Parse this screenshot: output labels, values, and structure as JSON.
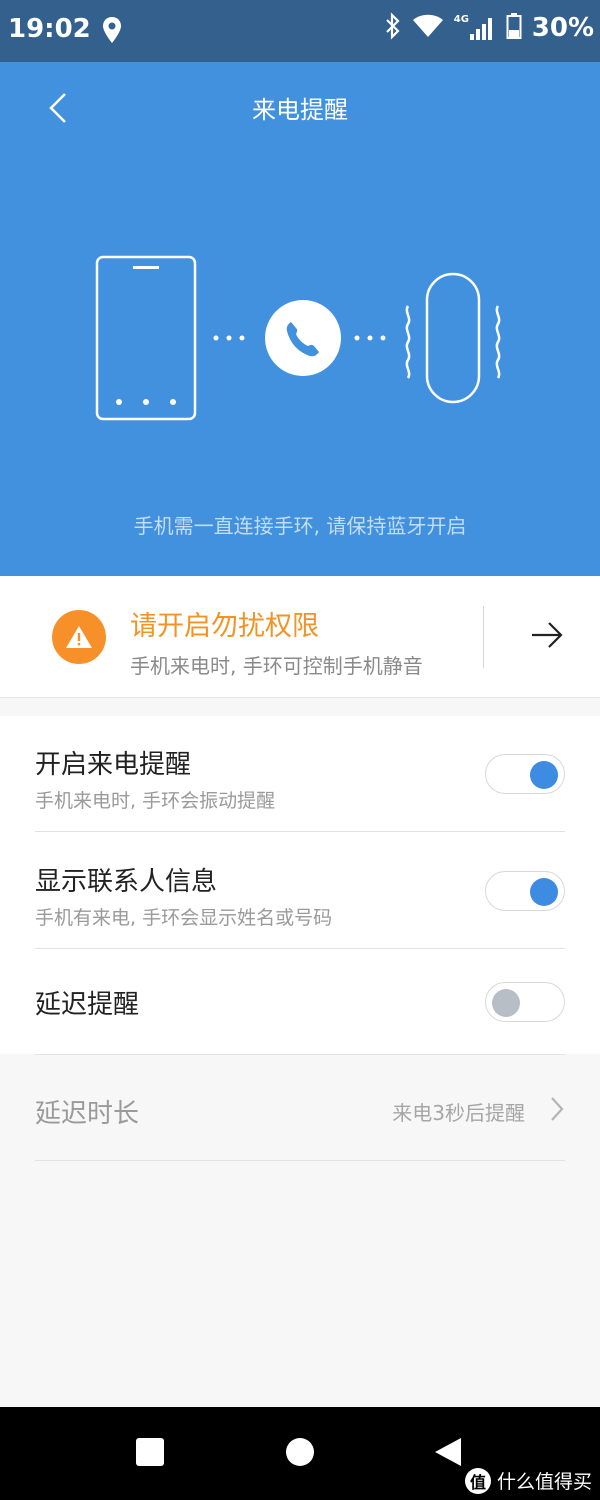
{
  "status_bar": {
    "time": "19:02",
    "battery_text": "30%",
    "network_label": "4G",
    "icons": [
      "location-icon",
      "bluetooth-icon",
      "wifi-icon",
      "signal-icon",
      "battery-icon"
    ]
  },
  "header": {
    "title": "来电提醒",
    "caption": "手机需一直连接手环, 请保持蓝牙开启",
    "background": "#4191df"
  },
  "dnd_card": {
    "title": "请开启勿扰权限",
    "subtitle": "手机来电时, 手环可控制手机静音",
    "accent": "#f39325"
  },
  "settings": {
    "items": [
      {
        "title": "开启来电提醒",
        "subtitle": "手机来电时, 手环会振动提醒",
        "enabled": true
      },
      {
        "title": "显示联系人信息",
        "subtitle": "手机有来电, 手环会显示姓名或号码",
        "enabled": true
      },
      {
        "title": "延迟提醒",
        "subtitle": "",
        "enabled": false
      }
    ],
    "delay": {
      "title": "延迟时长",
      "value": "来电3秒后提醒"
    }
  },
  "watermark": {
    "logo": "值",
    "text": "什么值得买"
  }
}
